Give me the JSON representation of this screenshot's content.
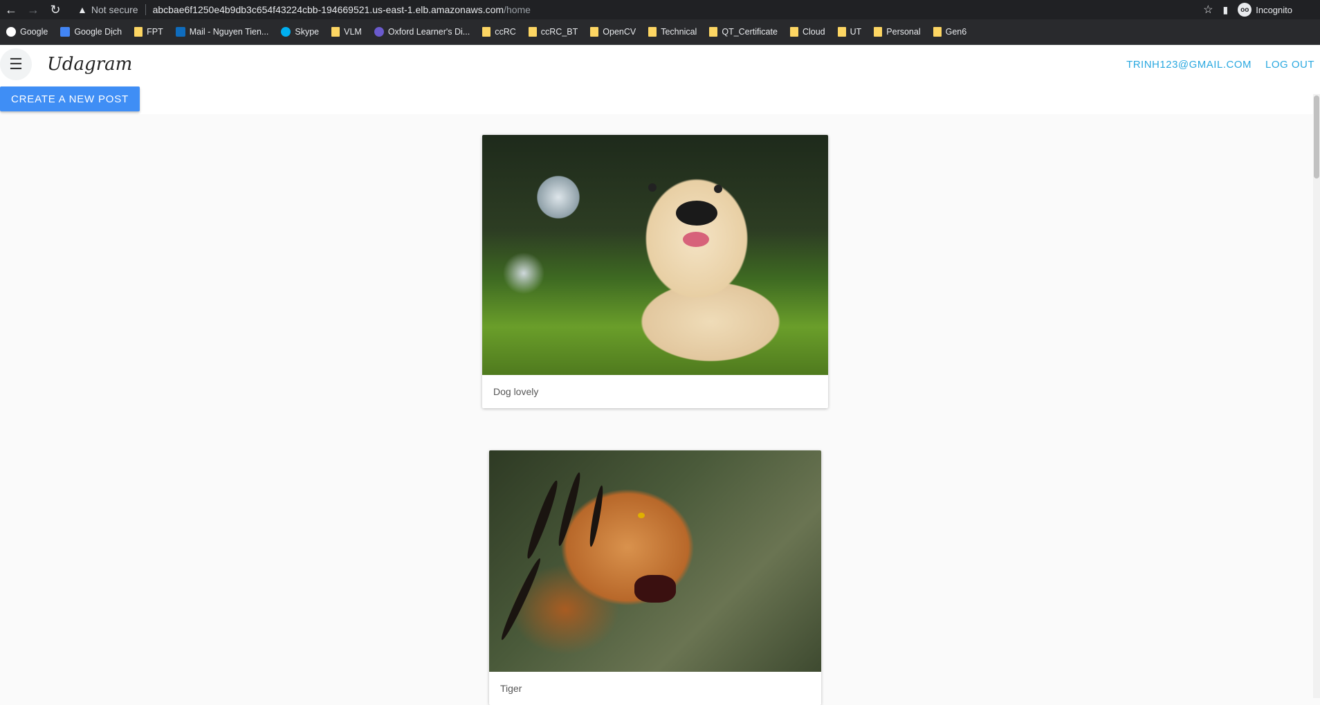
{
  "browser": {
    "security_label": "Not secure",
    "url_host": "abcbae6f1250e4b9db3c654f43224cbb-194669521.us-east-1.elb.amazonaws.com",
    "url_path": "/home",
    "profile_label": "Incognito",
    "bookmarks": [
      "Google",
      "Google Dịch",
      "FPT",
      "Mail - Nguyen Tien...",
      "Skype",
      "VLM",
      "Oxford Learner's Di...",
      "ccRC",
      "ccRC_BT",
      "OpenCV",
      "Technical",
      "QT_Certificate",
      "Cloud",
      "UT",
      "Personal",
      "Gen6"
    ]
  },
  "app": {
    "logo": "Udagram",
    "user_email": "TRINH123@GMAIL.COM",
    "logout_label": "LOG OUT",
    "create_button": "CREATE A NEW POST"
  },
  "posts": [
    {
      "caption": "Dog lovely",
      "image": "golden-retriever-puppy-photo"
    },
    {
      "caption": "Tiger",
      "image": "tiger-photo"
    }
  ],
  "colors": {
    "accent": "#3f8ef5",
    "link": "#29a8e0"
  }
}
